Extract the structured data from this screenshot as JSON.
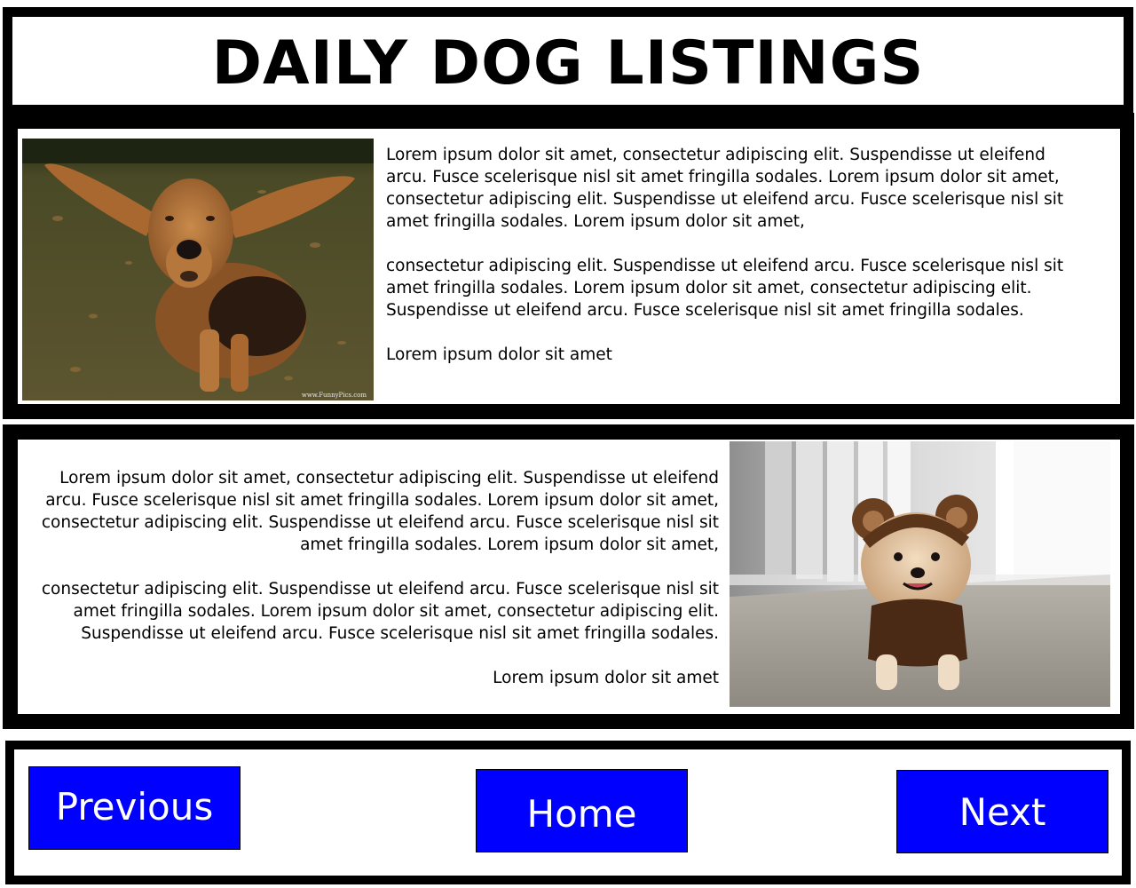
{
  "header": {
    "title": "DAILY DOG LISTINGS"
  },
  "listings": [
    {
      "photo_icon": "bloodhound-photo",
      "watermark": "www.FunnyPics.com",
      "paragraphs": [
        "Lorem ipsum dolor sit amet, consectetur adipiscing elit. Suspendisse ut eleifend arcu. Fusce scelerisque nisl sit amet fringilla sodales. Lorem ipsum dolor sit amet, consectetur adipiscing elit. Suspendisse ut eleifend arcu. Fusce scelerisque nisl sit amet fringilla sodales. Lorem ipsum dolor sit amet,",
        "consectetur adipiscing elit. Suspendisse ut eleifend arcu. Fusce scelerisque nisl sit amet fringilla sodales. Lorem ipsum dolor sit amet, consectetur adipiscing elit. Suspendisse ut eleifend arcu. Fusce scelerisque nisl sit amet fringilla sodales.",
        "Lorem ipsum dolor sit amet"
      ]
    },
    {
      "photo_icon": "pomeranian-photo",
      "paragraphs": [
        "Lorem ipsum dolor sit amet, consectetur adipiscing elit. Suspendisse ut eleifend arcu. Fusce scelerisque nisl sit amet fringilla sodales. Lorem ipsum dolor sit amet, consectetur adipiscing elit. Suspendisse ut eleifend arcu. Fusce scelerisque nisl sit amet fringilla sodales. Lorem ipsum dolor sit amet,",
        "consectetur adipiscing elit. Suspendisse ut eleifend arcu. Fusce scelerisque nisl sit amet fringilla sodales. Lorem ipsum dolor sit amet, consectetur adipiscing elit. Suspendisse ut eleifend arcu. Fusce scelerisque nisl sit amet fringilla sodales.",
        "Lorem ipsum dolor sit amet"
      ]
    }
  ],
  "nav": {
    "previous_label": "Previous",
    "home_label": "Home",
    "next_label": "Next"
  },
  "colors": {
    "button_bg": "#0000ff",
    "frame": "#000000"
  }
}
